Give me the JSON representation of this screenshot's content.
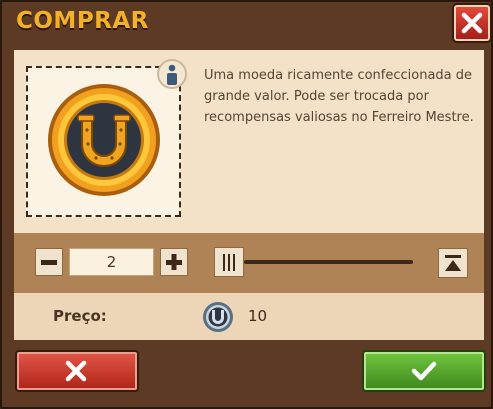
{
  "dialog": {
    "title": "COMPRAR",
    "close_icon": "close-icon"
  },
  "item": {
    "icon": "horseshoe-coin-icon",
    "info_icon": "info-icon",
    "description": "Uma moeda ricamente confeccionada de grande valor. Pode ser trocada por recompensas valiosas no Ferreiro Mestre."
  },
  "quantity": {
    "minus_icon": "minus-icon",
    "plus_icon": "plus-icon",
    "value": "2",
    "slider_level": 0,
    "max_icon": "max-icon"
  },
  "price": {
    "label": "Preço:",
    "currency_icon": "horseshoe-coin-icon",
    "value": "10"
  },
  "actions": {
    "cancel_icon": "cross-icon",
    "confirm_icon": "checkmark-icon"
  },
  "colors": {
    "title": "#f3b12a",
    "cancel": "#c8362a",
    "confirm": "#55a82e"
  }
}
